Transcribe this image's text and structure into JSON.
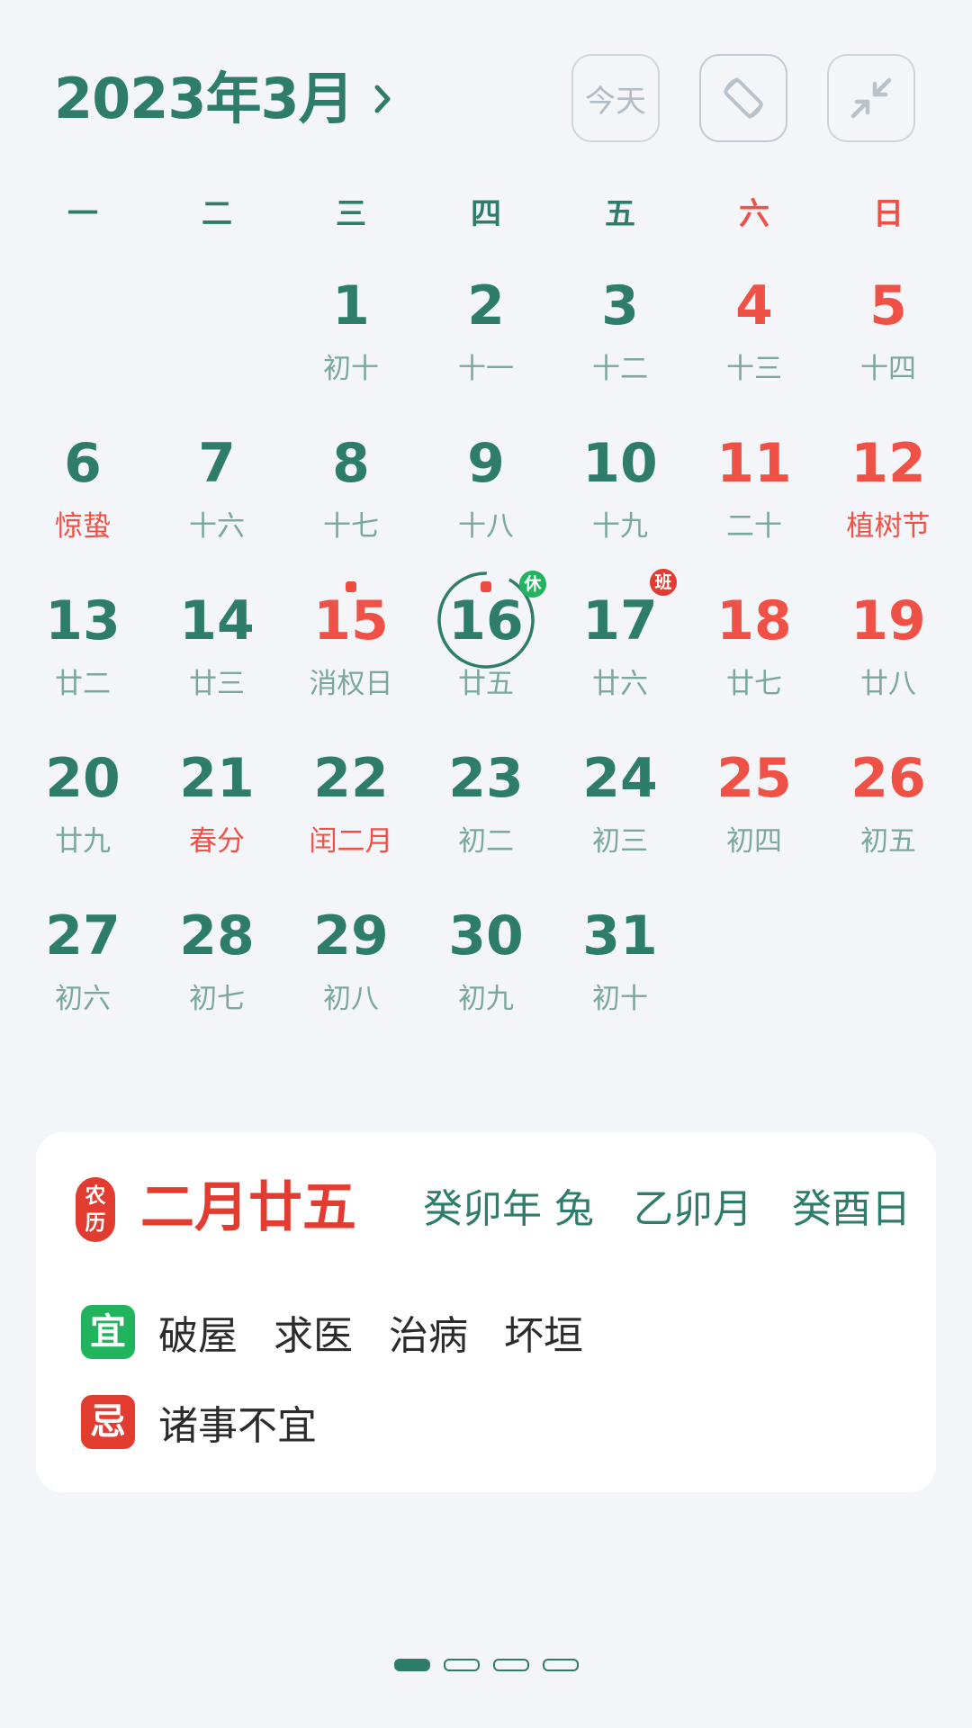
{
  "header": {
    "month_title": "2023年3月",
    "today_button": "今天"
  },
  "weekdays": [
    "一",
    "二",
    "三",
    "四",
    "五",
    "六",
    "日"
  ],
  "calendar": {
    "weeks": [
      [
        null,
        null,
        {
          "day": "1",
          "lunar": "初十"
        },
        {
          "day": "2",
          "lunar": "十一"
        },
        {
          "day": "3",
          "lunar": "十二"
        },
        {
          "day": "4",
          "lunar": "十三",
          "red": true
        },
        {
          "day": "5",
          "lunar": "十四",
          "red": true
        }
      ],
      [
        {
          "day": "6",
          "lunar": "惊蛰",
          "lunar_red": true
        },
        {
          "day": "7",
          "lunar": "十六"
        },
        {
          "day": "8",
          "lunar": "十七"
        },
        {
          "day": "9",
          "lunar": "十八"
        },
        {
          "day": "10",
          "lunar": "十九"
        },
        {
          "day": "11",
          "lunar": "二十",
          "red": true
        },
        {
          "day": "12",
          "lunar": "植树节",
          "red": true,
          "lunar_red": true
        }
      ],
      [
        {
          "day": "13",
          "lunar": "廿二"
        },
        {
          "day": "14",
          "lunar": "廿三"
        },
        {
          "day": "15",
          "lunar": "消权日",
          "red": true,
          "dot": true
        },
        {
          "day": "16",
          "lunar": "廿五",
          "today": true,
          "dot": true,
          "badge": "休",
          "badge_type": "rest"
        },
        {
          "day": "17",
          "lunar": "廿六",
          "badge": "班",
          "badge_type": "work"
        },
        {
          "day": "18",
          "lunar": "廿七",
          "red": true
        },
        {
          "day": "19",
          "lunar": "廿八",
          "red": true
        }
      ],
      [
        {
          "day": "20",
          "lunar": "廿九"
        },
        {
          "day": "21",
          "lunar": "春分",
          "lunar_red": true
        },
        {
          "day": "22",
          "lunar": "闰二月",
          "lunar_red": true
        },
        {
          "day": "23",
          "lunar": "初二"
        },
        {
          "day": "24",
          "lunar": "初三"
        },
        {
          "day": "25",
          "lunar": "初四",
          "red": true
        },
        {
          "day": "26",
          "lunar": "初五",
          "red": true
        }
      ],
      [
        {
          "day": "27",
          "lunar": "初六"
        },
        {
          "day": "28",
          "lunar": "初七"
        },
        {
          "day": "29",
          "lunar": "初八"
        },
        {
          "day": "30",
          "lunar": "初九"
        },
        {
          "day": "31",
          "lunar": "初十"
        },
        null,
        null
      ]
    ]
  },
  "info_card": {
    "lunar_tag_top": "农",
    "lunar_tag_bottom": "历",
    "lunar_date": "二月廿五",
    "year_gz": "癸卯年 兔",
    "month_gz": "乙卯月",
    "day_gz": "癸酉日",
    "yi_label": "宜",
    "yi_items": [
      "破屋",
      "求医",
      "治病",
      "坏垣"
    ],
    "ji_label": "忌",
    "ji_items": [
      "诸事不宜"
    ]
  },
  "pager": {
    "count": 4,
    "active": 0
  },
  "colors": {
    "primary": "#2e7d6a",
    "weekend": "#ef5147",
    "lunar_text": "#7aa89a",
    "rest_badge": "#22b35e",
    "work_badge": "#e23b30",
    "background": "#f4f5f9"
  }
}
